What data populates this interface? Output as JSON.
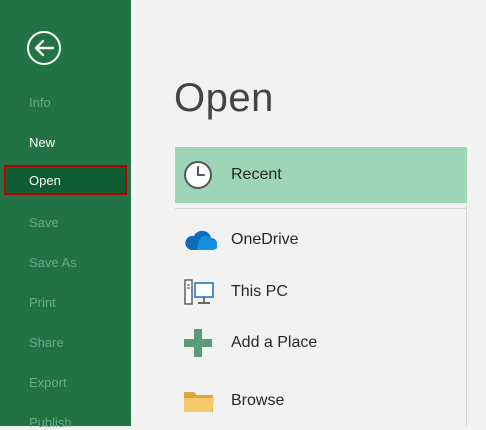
{
  "sidebar": {
    "back_icon": "back-arrow-icon",
    "items": [
      {
        "label": "Info",
        "enabled": false
      },
      {
        "label": "New",
        "enabled": true
      },
      {
        "label": "Open",
        "enabled": true,
        "active": true
      },
      {
        "label": "Save",
        "enabled": false
      },
      {
        "label": "Save As",
        "enabled": false
      },
      {
        "label": "Print",
        "enabled": false
      },
      {
        "label": "Share",
        "enabled": false
      },
      {
        "label": "Export",
        "enabled": false
      },
      {
        "label": "Publish",
        "enabled": false
      }
    ]
  },
  "main": {
    "title": "Open",
    "locations": [
      {
        "label": "Recent",
        "icon": "clock-icon",
        "selected": true
      },
      {
        "label": "OneDrive",
        "icon": "cloud-icon"
      },
      {
        "label": "This PC",
        "icon": "computer-icon"
      },
      {
        "label": "Add a Place",
        "icon": "plus-icon"
      },
      {
        "label": "Browse",
        "icon": "folder-icon"
      }
    ]
  },
  "colors": {
    "sidebar_bg": "#217346",
    "active_item_bg": "#0f5d33",
    "active_item_border": "#c00000",
    "selected_location_bg": "#9fd5b7",
    "content_bg": "#f2f2f2"
  }
}
